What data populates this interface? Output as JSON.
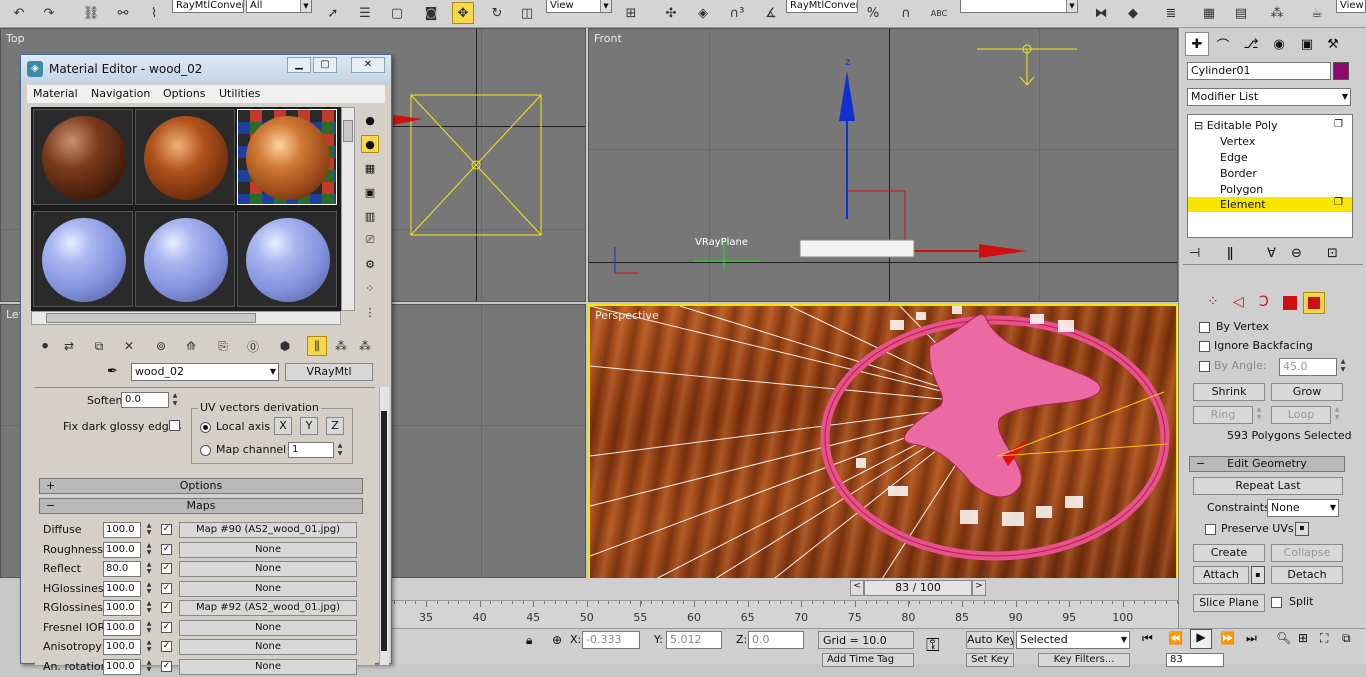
{
  "toolbar": {
    "selection_set_left": "RayMtlConvert",
    "filter": "All",
    "ref_coord": "View",
    "selection_set_right": "RayMtlConvert",
    "view_label": "View",
    "abc_label": "ABC"
  },
  "viewports": {
    "top_label": "Top",
    "front_label": "Front",
    "left_label": "Left",
    "perspective_label": "Perspective",
    "vray_plane_label": "VRayPlane"
  },
  "command_panel": {
    "object_name": "Cylinder01",
    "object_color": "#8b0a6b",
    "modifier_list_label": "Modifier List",
    "stack": [
      "Editable Poly",
      "Vertex",
      "Edge",
      "Border",
      "Polygon",
      "Element"
    ],
    "selection": {
      "by_vertex": "By Vertex",
      "ignore_backfacing": "Ignore Backfacing",
      "by_angle": "By Angle:",
      "by_angle_value": "45.0",
      "shrink": "Shrink",
      "grow": "Grow",
      "ring": "Ring",
      "loop": "Loop",
      "status": "593 Polygons Selected"
    },
    "edit_geometry": {
      "title": "Edit Geometry",
      "repeat_last": "Repeat Last",
      "constraints_label": "Constraints:",
      "constraints_value": "None",
      "preserve_uvs": "Preserve UVs",
      "create": "Create",
      "collapse": "Collapse",
      "attach": "Attach",
      "detach": "Detach",
      "slice_plane": "Slice Plane",
      "split": "Split"
    }
  },
  "material_editor": {
    "title": "Material Editor - wood_02",
    "menu": [
      "Material",
      "Navigation",
      "Options",
      "Utilities"
    ],
    "material_name": "wood_02",
    "material_type": "VRayMtl",
    "soften_label": "Soften",
    "soften_value": "0.0",
    "fix_dark_glossy": "Fix dark glossy edges",
    "uv_vectors_title": "UV vectors derivation",
    "local_axis": "Local axis",
    "axis_x": "X",
    "axis_y": "Y",
    "axis_z": "Z",
    "map_channel": "Map channel",
    "map_channel_value": "1",
    "options_rollout": "Options",
    "maps_rollout": "Maps",
    "maps": [
      {
        "name": "Diffuse",
        "value": "100.0",
        "map": "Map #90 (AS2_wood_01.jpg)"
      },
      {
        "name": "Roughness",
        "value": "100.0",
        "map": "None"
      },
      {
        "name": "Reflect",
        "value": "80.0",
        "map": "None"
      },
      {
        "name": "HGlossiness",
        "value": "100.0",
        "map": "None"
      },
      {
        "name": "RGlossiness",
        "value": "100.0",
        "map": "Map #92 (AS2_wood_01.jpg)"
      },
      {
        "name": "Fresnel IOR",
        "value": "100.0",
        "map": "None"
      },
      {
        "name": "Anisotropy",
        "value": "100.0",
        "map": "None"
      },
      {
        "name": "An. rotation",
        "value": "100.0",
        "map": "None"
      }
    ]
  },
  "timeline": {
    "frame_label": "83 / 100",
    "ticks": [
      "35",
      "40",
      "45",
      "50",
      "55",
      "60",
      "65",
      "70",
      "75",
      "80",
      "85",
      "90",
      "95",
      "100"
    ]
  },
  "status": {
    "x_label": "X:",
    "x_value": "-0.333",
    "y_label": "Y:",
    "y_value": "5.012",
    "z_label": "Z:",
    "z_value": "0.0",
    "grid": "Grid = 10.0",
    "auto_key": "Auto Key",
    "selected": "Selected",
    "set_key": "Set Key",
    "key_filters": "Key Filters...",
    "add_time_tag": "Add Time Tag",
    "current_frame": "83"
  }
}
